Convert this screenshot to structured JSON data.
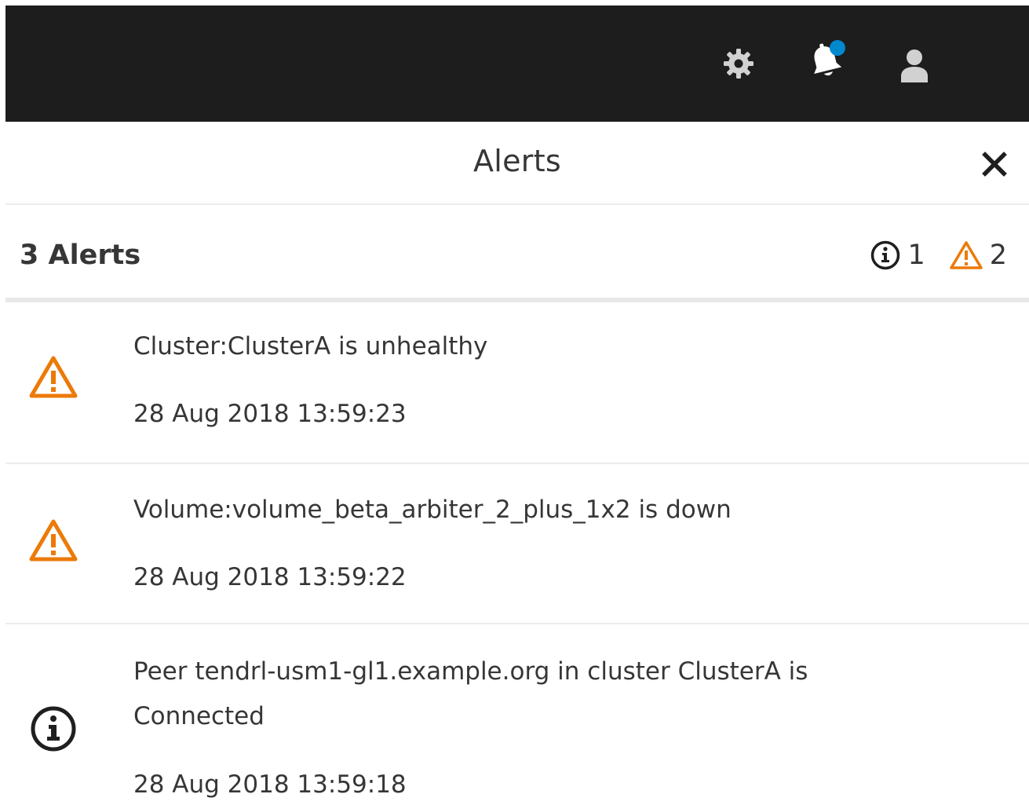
{
  "navbar": {
    "icons": [
      "gear-icon",
      "bell-icon",
      "user-icon"
    ],
    "notification_dot_color": "#0088ce"
  },
  "drawer": {
    "title": "Alerts",
    "close_icon": "close-icon"
  },
  "summary": {
    "count_label": "3 Alerts",
    "info_count": "1",
    "warning_count": "2"
  },
  "alerts": [
    {
      "severity": "warning",
      "icon": "warning-icon",
      "message": "Cluster:ClusterA is unhealthy",
      "timestamp": "28 Aug 2018 13:59:23"
    },
    {
      "severity": "warning",
      "icon": "warning-icon",
      "message": "Volume:volume_beta_arbiter_2_plus_1x2 is down",
      "timestamp": "28 Aug 2018 13:59:22"
    },
    {
      "severity": "info",
      "icon": "info-icon",
      "message": "Peer tendrl-usm1-gl1.example.org in cluster ClusterA is Connected",
      "timestamp": "28 Aug 2018 13:59:18"
    }
  ],
  "colors": {
    "navbar_bg": "#1d1d1d",
    "warning": "#ec7a08",
    "text": "#363636",
    "accent": "#0088ce"
  }
}
